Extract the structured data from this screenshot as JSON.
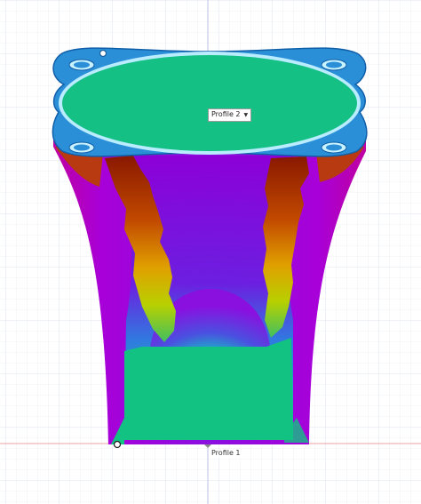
{
  "profiles": {
    "top": {
      "label": "Profile 2",
      "dropdown_icon": "chevron-down-icon"
    },
    "bottom": {
      "label": "Profile 1"
    }
  },
  "colors": {
    "grid_minor": "#eef1f6",
    "grid_major": "#dfe4ec",
    "x_axis": "#e8a0a0",
    "y_axis": "#b8c2e6",
    "top_face": "#14c084",
    "flange_blue": "#2b8fd8",
    "outline_light": "#b9ecff",
    "hot": "#9b2200",
    "cold": "#10c080",
    "body_magenta": "#b000d0"
  }
}
